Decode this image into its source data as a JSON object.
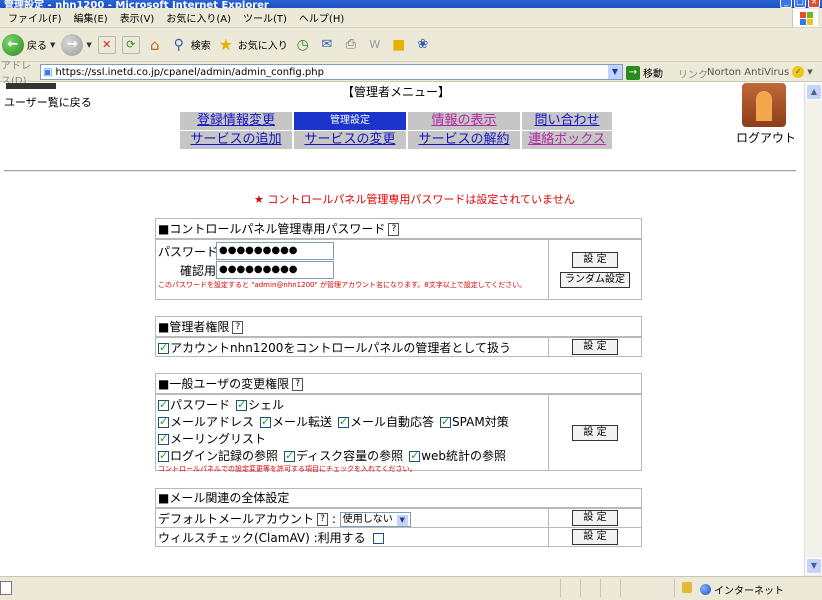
{
  "window": {
    "title": "管理設定 - nhn1200 - Microsoft Internet Explorer"
  },
  "menu": [
    "ファイル(F)",
    "編集(E)",
    "表示(V)",
    "お気に入り(A)",
    "ツール(T)",
    "ヘルプ(H)"
  ],
  "toolbar": {
    "back": "戻る",
    "search": "検索",
    "favorites": "お気に入り"
  },
  "address": {
    "label": "アドレス(D)",
    "url": "https://ssl.inetd.co.jp/cpanel/admin/admin_config.php",
    "go": "移動",
    "links": "リンク",
    "norton": "Norton AntiVirus"
  },
  "page": {
    "back_link": "ユーザー覧に戻る",
    "admin_menu_title": "【管理者メニュー】",
    "logout": "ログアウト",
    "nav_row1": [
      {
        "label": "登録情報変更",
        "state": "link"
      },
      {
        "label": "管理設定",
        "state": "active"
      },
      {
        "label": "情報の表示",
        "state": "visited"
      },
      {
        "label": "問い合わせ",
        "state": "link"
      }
    ],
    "nav_row2": [
      {
        "label": "サービスの追加",
        "state": "link"
      },
      {
        "label": "サービスの変更",
        "state": "link"
      },
      {
        "label": "サービスの解約",
        "state": "link"
      },
      {
        "label": "連絡ボックス",
        "state": "visited"
      }
    ],
    "warning": "★ コントロールパネル管理専用パスワードは設定されていません"
  },
  "password_panel": {
    "heading": "■コントロールパネル管理専用パスワード",
    "qmark": "?",
    "password_label": "パスワード",
    "password_value": "●●●●●●●●●",
    "confirm_label": "確認用",
    "confirm_value": "●●●●●●●●●",
    "note": "このパスワードを設定すると \"admin@nhn1200\" が管理アカウント名になります。8文字以上で設定してください。",
    "set_button": "設 定",
    "random_button": "ランダム設定"
  },
  "admin_panel": {
    "heading": "■管理者権限",
    "qmark": "?",
    "option": "アカウントnhn1200をコントロールパネルの管理者として扱う",
    "set_button": "設 定"
  },
  "user_panel": {
    "heading": "■一般ユーザの変更権限",
    "qmark": "?",
    "row1": [
      "パスワード",
      "シェル"
    ],
    "row2": [
      "メールアドレス",
      "メール転送",
      "メール自動応答",
      "SPAM対策"
    ],
    "row3": [
      "メーリングリスト"
    ],
    "row4": [
      "ログイン記録の参照",
      "ディスク容量の参照",
      "web統計の参照"
    ],
    "note": "コントロールパネルでの設定変更等を許可する項目にチェックを入れてください。",
    "set_button": "設 定"
  },
  "mail_panel": {
    "heading": "■メール関連の全体設定",
    "default_account_label": "デフォルトメールアカウント",
    "qmark": "?",
    "colon": ":",
    "select_value": "使用しない",
    "virus_label": "ウィルスチェック(ClamAV) :利用する",
    "set_button": "設 定"
  },
  "status": {
    "zone": "インターネット"
  }
}
